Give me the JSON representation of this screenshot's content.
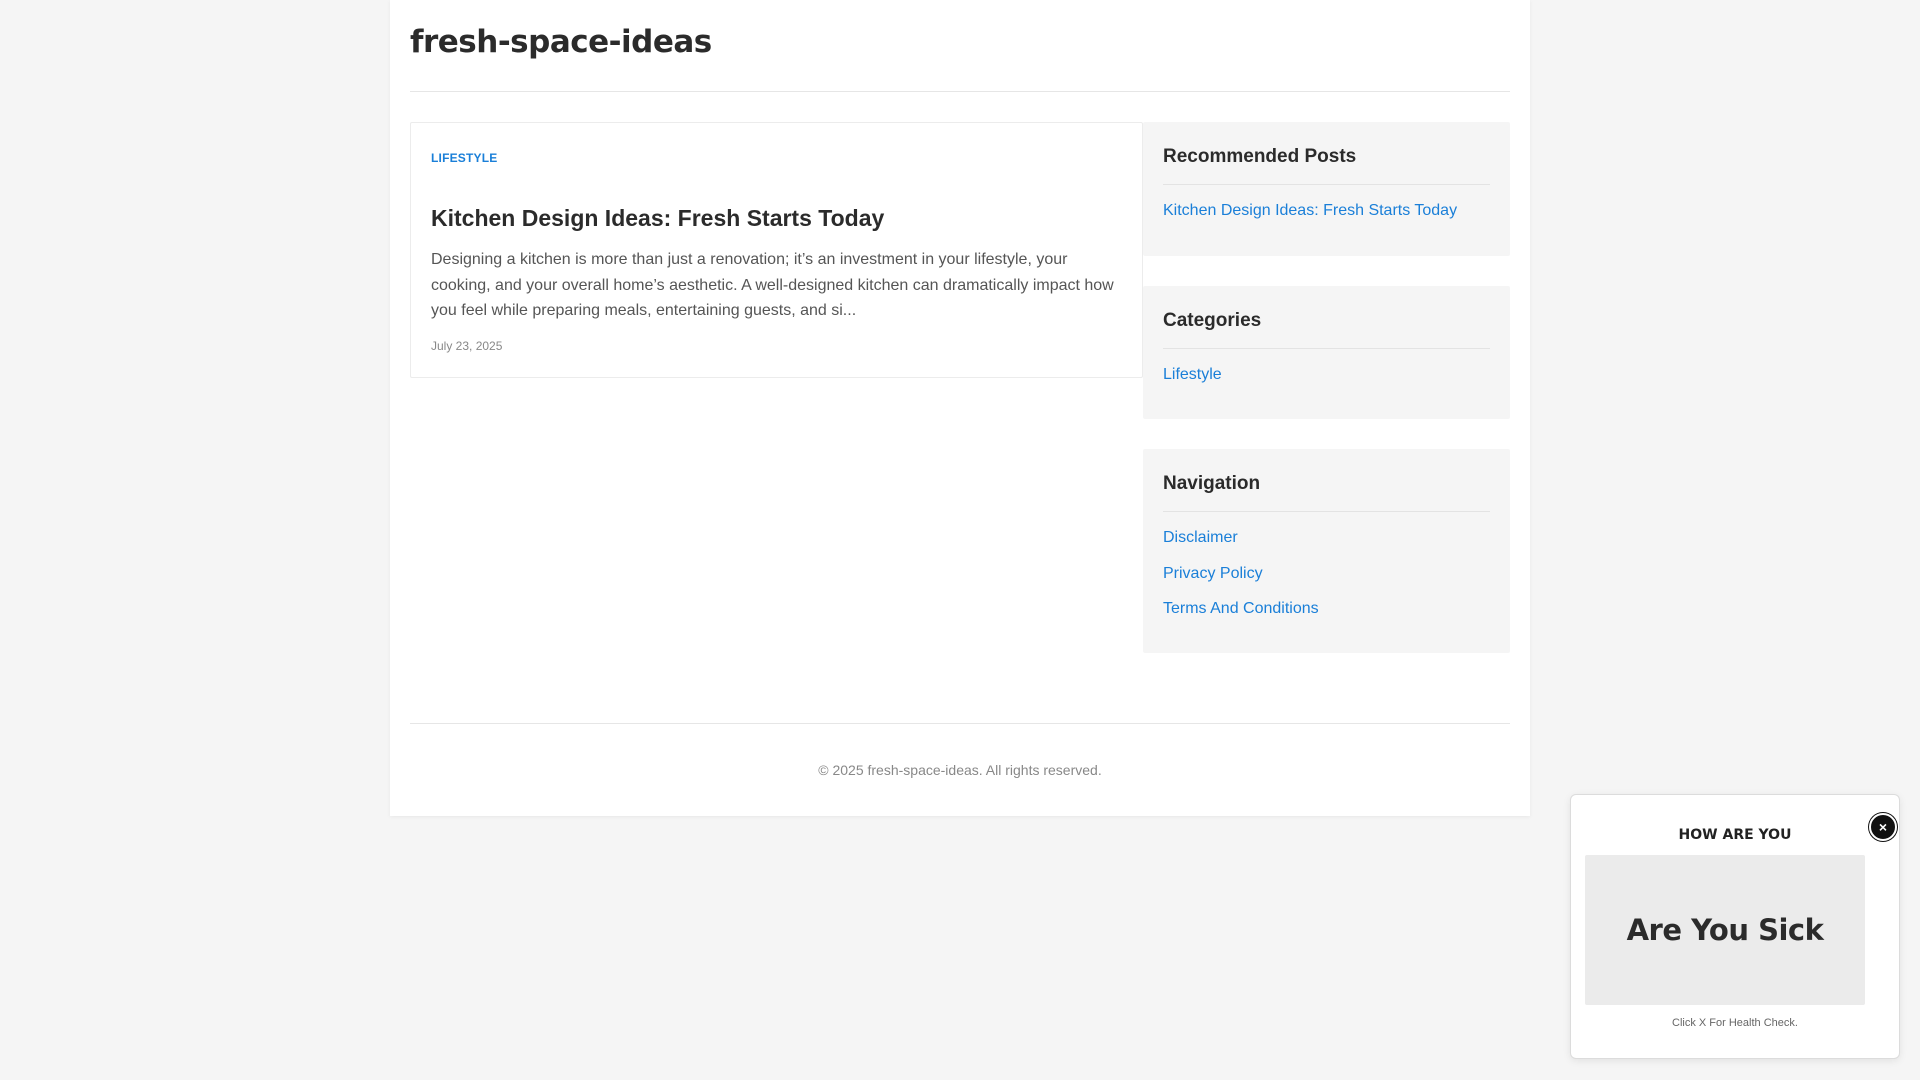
{
  "site": {
    "title": "fresh-space-ideas"
  },
  "post": {
    "category": "LIFESTYLE",
    "title": "Kitchen Design Ideas: Fresh Starts Today",
    "excerpt": "Designing a kitchen is more than just a renovation; it’s an investment in your lifestyle, your cooking, and your overall home’s aesthetic. A well-designed kitchen can dramatically impact how you feel while preparing meals, entertaining guests, and si...",
    "date": "July 23, 2025"
  },
  "sidebar": {
    "recommended": {
      "title": "Recommended Posts",
      "links": [
        "Kitchen Design Ideas: Fresh Starts Today"
      ]
    },
    "categories": {
      "title": "Categories",
      "links": [
        "Lifestyle"
      ]
    },
    "navigation": {
      "title": "Navigation",
      "links": [
        "Disclaimer",
        "Privacy Policy",
        "Terms And Conditions"
      ]
    }
  },
  "footer": {
    "text": "© 2025 fresh-space-ideas. All rights reserved."
  },
  "popup": {
    "heading": "HOW ARE YOU",
    "close_label": "×",
    "banner_text": "Are You Sick",
    "caption": "Click X For Health Check."
  },
  "colors": {
    "link": "#1a7fd8",
    "background": "#f5f5f5",
    "card": "#ffffff",
    "widget": "#f5f5f5"
  },
  "icons": {
    "popup_close": "close-icon"
  }
}
